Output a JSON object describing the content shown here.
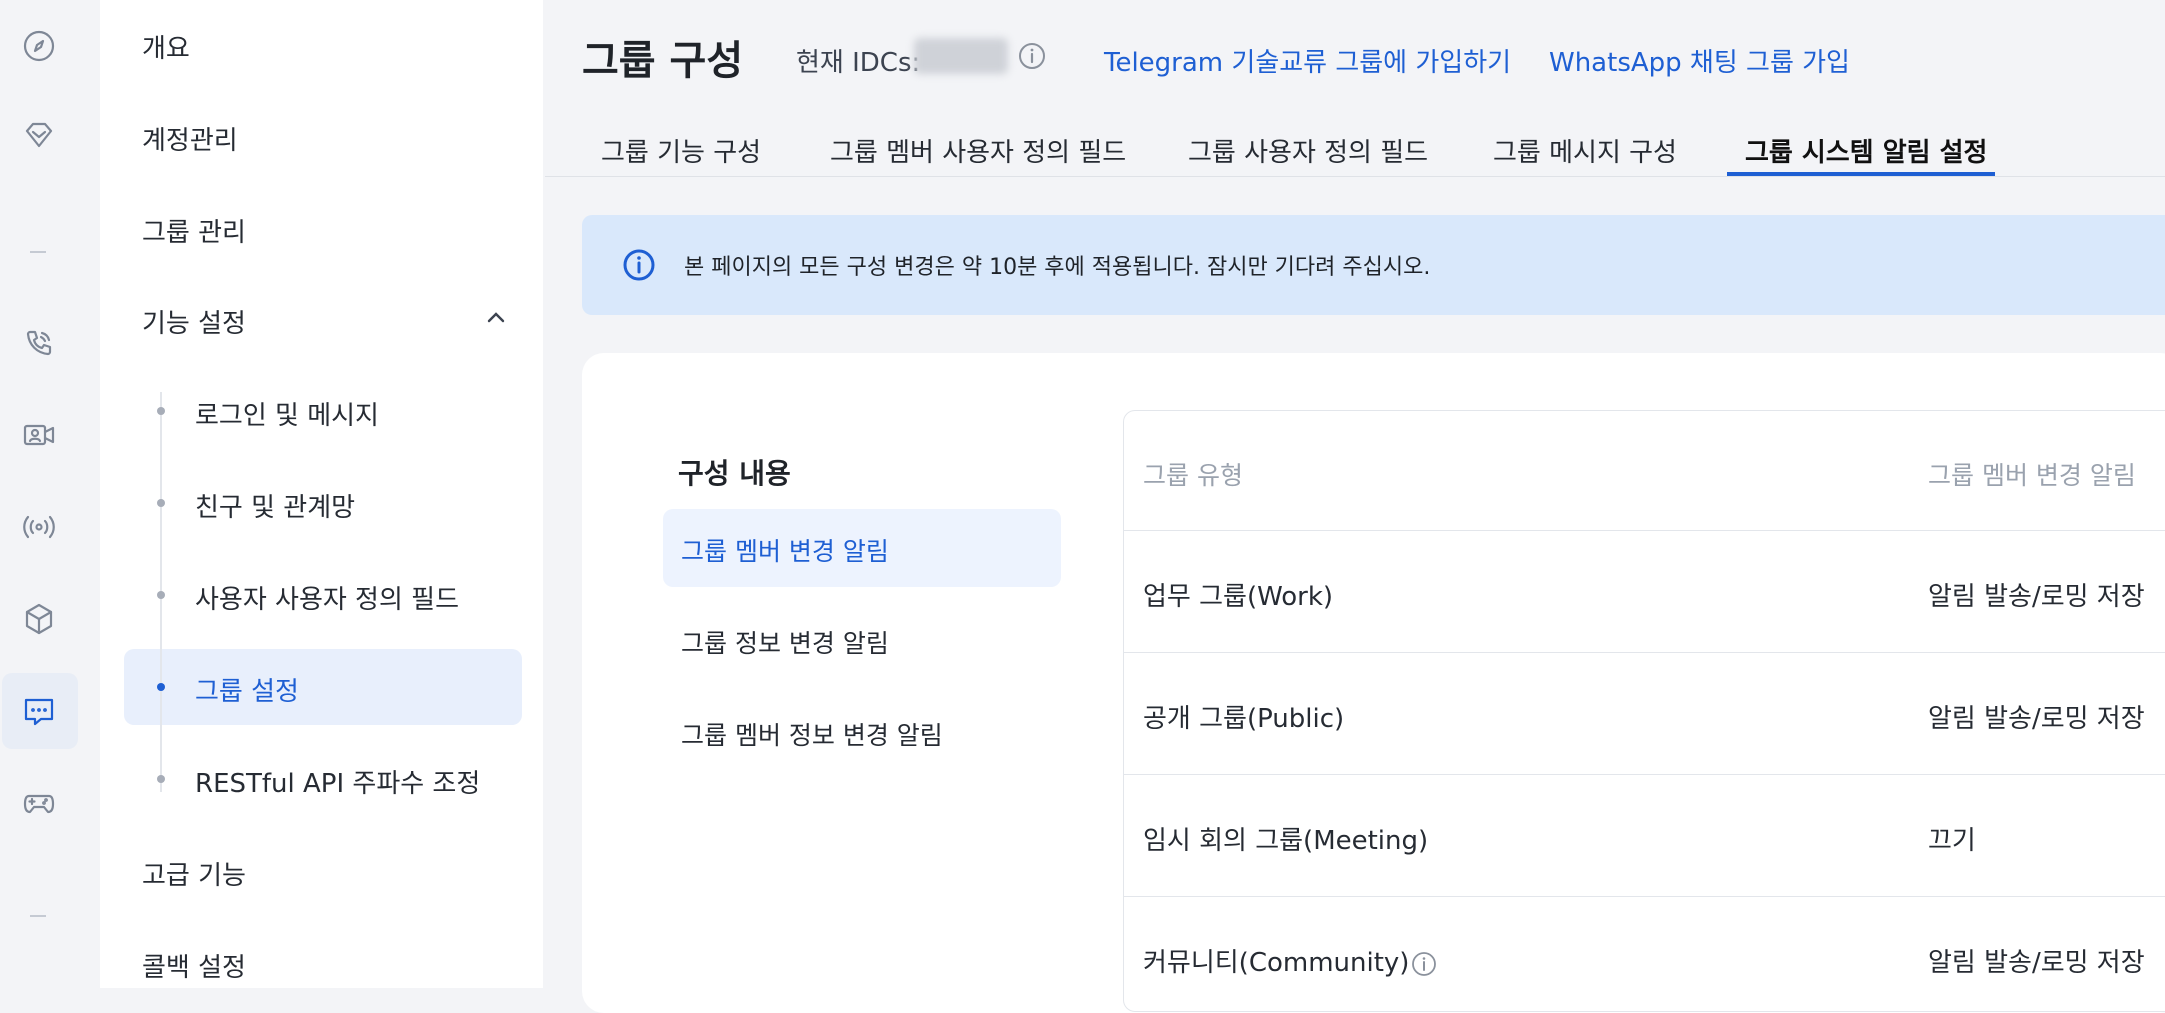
{
  "rail": {
    "icons": [
      "compass-icon",
      "diamond-icon",
      "phone-icon",
      "video-icon",
      "broadcast-icon",
      "cube-icon",
      "chat-icon",
      "gamepad-icon"
    ],
    "active": "chat-icon"
  },
  "menu": {
    "overview": "개요",
    "account": "계정관리",
    "group_mgmt": "그룹 관리",
    "feature_settings": "기능 설정",
    "sub": {
      "login_msg": "로그인 및 메시지",
      "friends": "친구 및 관계망",
      "user_fields": "사용자 사용자 정의 필드",
      "group_settings": "그룹 설정",
      "restful": "RESTful API 주파수 조정"
    },
    "advanced": "고급 기능",
    "callback": "콜백 설정"
  },
  "header": {
    "title": "그룹 구성",
    "idc_label": "현재 IDCs:",
    "telegram_link": "Telegram 기술교류 그룹에 가입하기",
    "whatsapp_link": "WhatsApp 채팅 그룹 가입"
  },
  "tabs": [
    "그룹 기능 구성",
    "그룹 멤버 사용자 정의 필드",
    "그룹 사용자 정의 필드",
    "그룹 메시지 구성",
    "그룹 시스템 알림 설정"
  ],
  "notice": "본 페이지의 모든 구성 변경은 약 10분 후에 적용됩니다. 잠시만 기다려 주십시오.",
  "config": {
    "title": "구성 내용",
    "items": [
      "그룹 멤버 변경 알림",
      "그룹 정보 변경 알림",
      "그룹 멤버 정보 변경 알림"
    ]
  },
  "table": {
    "headers": [
      "그룹 유형",
      "그룹 멤버 변경 알림"
    ],
    "rows": [
      {
        "type": "업무 그룹(Work)",
        "value": "알림 발송/로밍 저장"
      },
      {
        "type": "공개 그룹(Public)",
        "value": "알림 발송/로밍 저장"
      },
      {
        "type": "임시 회의 그룹(Meeting)",
        "value": "끄기"
      },
      {
        "type": "커뮤니티(Community)",
        "value": "알림 발송/로밍 저장"
      }
    ]
  },
  "colors": {
    "accent": "#1e5fd3",
    "notice_bg": "#d9e8fb",
    "active_bg": "#e8effc"
  }
}
